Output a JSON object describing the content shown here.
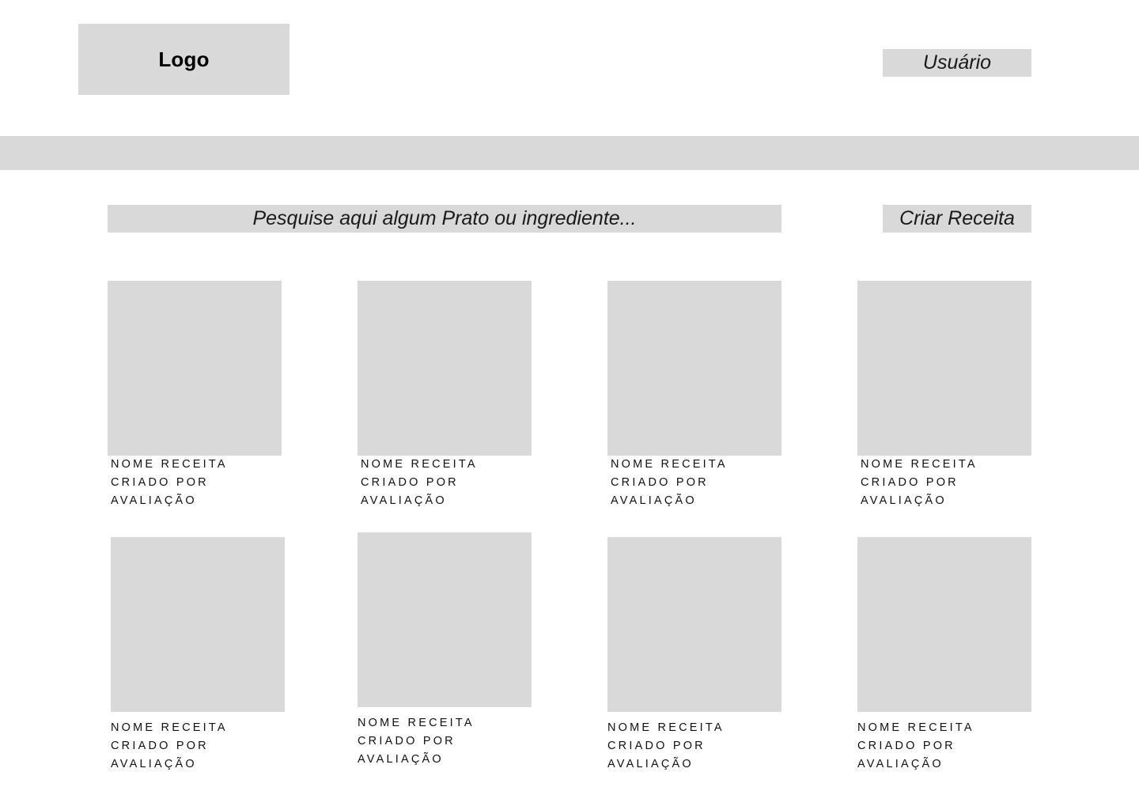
{
  "header": {
    "logo_text": "Logo",
    "user_label": "Usuário"
  },
  "search": {
    "placeholder": "Pesquise  aqui algum Prato ou ingrediente..."
  },
  "actions": {
    "create_recipe_label": "Criar Receita"
  },
  "recipes": [
    {
      "name": "NOME RECEITA",
      "author": "CRIADO POR",
      "rating": "AVALIAÇÃO"
    },
    {
      "name": "NOME RECEITA",
      "author": "CRIADO POR",
      "rating": "AVALIAÇÃO"
    },
    {
      "name": "NOME RECEITA",
      "author": "CRIADO POR",
      "rating": "AVALIAÇÃO"
    },
    {
      "name": "NOME RECEITA",
      "author": "CRIADO POR",
      "rating": "AVALIAÇÃO"
    },
    {
      "name": "NOME RECEITA",
      "author": "CRIADO POR",
      "rating": "AVALIAÇÃO"
    },
    {
      "name": "NOME RECEITA",
      "author": "CRIADO POR",
      "rating": "AVALIAÇÃO"
    },
    {
      "name": "NOME RECEITA",
      "author": "CRIADO POR",
      "rating": "AVALIAÇÃO"
    },
    {
      "name": "NOME RECEITA",
      "author": "CRIADO POR",
      "rating": "AVALIAÇÃO"
    }
  ],
  "colors": {
    "placeholder_gray": "#d9d9d9",
    "background": "#ffffff",
    "text": "#000000"
  }
}
